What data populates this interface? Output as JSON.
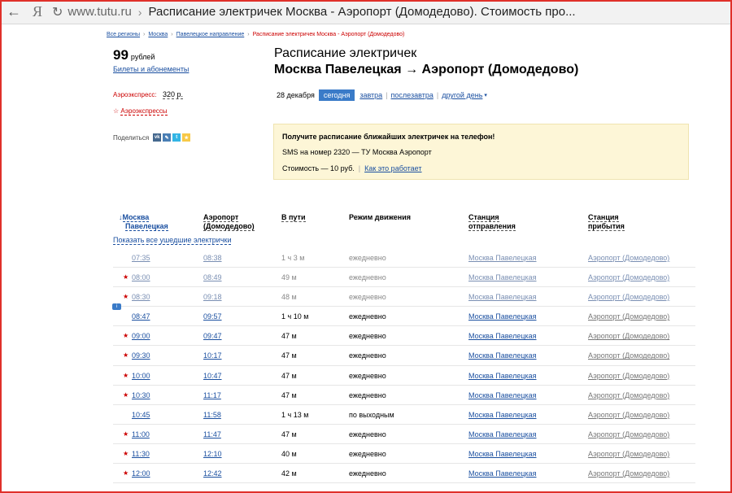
{
  "browser": {
    "back_icon": "←",
    "yandex_logo": "Я",
    "refresh_icon": "↻",
    "url": "www.tutu.ru",
    "sep": "›",
    "title": "Расписание электричек Москва - Аэропорт (Домодедово). Стоимость про..."
  },
  "breadcrumbs": {
    "items": [
      "Все регионы",
      "Москва",
      "Павелецкое направление",
      "Расписание электричек Москва - Аэропорт (Домодедово)"
    ],
    "sep": "›"
  },
  "price": {
    "value": "99",
    "unit": "рублей",
    "tickets_link": "Билеты и абонементы"
  },
  "aeroexpress": {
    "label": "Аэроэкспресс:",
    "price": "320 р.",
    "star": "☆",
    "link": "Аэроэкспрессы"
  },
  "share": {
    "label": "Поделиться",
    "icons": [
      "vk-icon",
      "lj-icon",
      "twitter-icon",
      "yandex-icon"
    ]
  },
  "header": {
    "title": "Расписание электричек",
    "route": "Москва Павелецкая → Аэропорт (Домодедово)"
  },
  "dates": {
    "current": "28 декабря",
    "today": "сегодня",
    "tomorrow": "завтра",
    "day_after": "послезавтра",
    "other_day": "другой день",
    "caret": "▾",
    "sep": "|"
  },
  "sms": {
    "heading": "Получите расписание ближайших электричек на телефон!",
    "line": "SMS на номер 2320 — ТУ Москва Аэропорт",
    "cost": "Стоимость — 10 руб.",
    "sep": "|",
    "how_link": "Как это работает"
  },
  "table": {
    "columns": {
      "arrow": "↓",
      "from_station": [
        "Москва",
        "Павелецкая"
      ],
      "to_station": [
        "Аэропорт",
        "(Домодедово)"
      ],
      "duration": "В пути",
      "mode": "Режим движения",
      "departure_station": [
        "Станция",
        "отправления"
      ],
      "arrival_station": [
        "Станция",
        "прибытия"
      ]
    },
    "show_all": "Показать все ушедшие электрички",
    "info_badge": "i",
    "rows": [
      {
        "star": "",
        "dep": "07:35",
        "arr": "08:38",
        "dur": "1 ч 3 м",
        "mode": "ежедневно",
        "from": "Москва Павелецкая",
        "to": "Аэропорт (Домодедово)"
      },
      {
        "star": "★",
        "dep": "08:00",
        "arr": "08:49",
        "dur": "49 м",
        "mode": "ежедневно",
        "from": "Москва Павелецкая",
        "to": "Аэропорт (Домодедово)"
      },
      {
        "star": "★",
        "dep": "08:30",
        "arr": "09:18",
        "dur": "48 м",
        "mode": "ежедневно",
        "from": "Москва Павелецкая",
        "to": "Аэропорт (Домодедово)"
      },
      {
        "star": "",
        "dep": "08:47",
        "arr": "09:57",
        "dur": "1 ч 10 м",
        "mode": "ежедневно",
        "from": "Москва Павелецкая",
        "to": "Аэропорт (Домодедово)"
      },
      {
        "star": "★",
        "dep": "09:00",
        "arr": "09:47",
        "dur": "47 м",
        "mode": "ежедневно",
        "from": "Москва Павелецкая",
        "to": "Аэропорт (Домодедово)"
      },
      {
        "star": "★",
        "dep": "09:30",
        "arr": "10:17",
        "dur": "47 м",
        "mode": "ежедневно",
        "from": "Москва Павелецкая",
        "to": "Аэропорт (Домодедово)"
      },
      {
        "star": "★",
        "dep": "10:00",
        "arr": "10:47",
        "dur": "47 м",
        "mode": "ежедневно",
        "from": "Москва Павелецкая",
        "to": "Аэропорт (Домодедово)"
      },
      {
        "star": "★",
        "dep": "10:30",
        "arr": "11:17",
        "dur": "47 м",
        "mode": "ежедневно",
        "from": "Москва Павелецкая",
        "to": "Аэропорт (Домодедово)"
      },
      {
        "star": "",
        "dep": "10:45",
        "arr": "11:58",
        "dur": "1 ч 13 м",
        "mode": "по выходным",
        "from": "Москва Павелецкая",
        "to": "Аэропорт (Домодедово)"
      },
      {
        "star": "★",
        "dep": "11:00",
        "arr": "11:47",
        "dur": "47 м",
        "mode": "ежедневно",
        "from": "Москва Павелецкая",
        "to": "Аэропорт (Домодедово)"
      },
      {
        "star": "★",
        "dep": "11:30",
        "arr": "12:10",
        "dur": "40 м",
        "mode": "ежедневно",
        "from": "Москва Павелецкая",
        "to": "Аэропорт (Домодедово)"
      },
      {
        "star": "★",
        "dep": "12:00",
        "arr": "12:42",
        "dur": "42 м",
        "mode": "ежедневно",
        "from": "Москва Павелецкая",
        "to": "Аэропорт (Домодедово)"
      }
    ]
  }
}
